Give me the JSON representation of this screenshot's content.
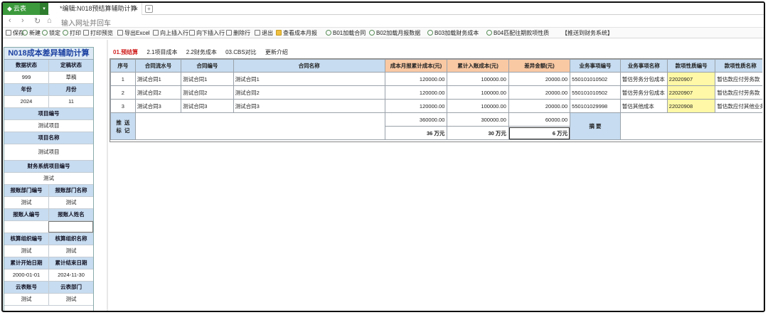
{
  "tabs": {
    "app_label": "云表",
    "doc_label": "*编辑:N018预结算辅助计算",
    "close": "×"
  },
  "address": {
    "placeholder": "输入网址并回车"
  },
  "toolbar": [
    {
      "label": "保存",
      "icon": "save-icon"
    },
    {
      "label": "新建",
      "icon": "new-icon"
    },
    {
      "label": "锁定",
      "icon": "lock-icon"
    },
    {
      "label": "打印",
      "icon": "print-icon"
    },
    {
      "label": "打印预览",
      "icon": "print-preview-icon"
    },
    {
      "label": "导出Excel",
      "icon": "excel-icon"
    },
    {
      "label": "向上插入行",
      "icon": "insert-up-icon"
    },
    {
      "label": "向下插入行",
      "icon": "insert-down-icon"
    },
    {
      "label": "删除行",
      "icon": "delete-row-icon"
    },
    {
      "label": "退出",
      "icon": "exit-icon"
    },
    {
      "label": "查看成本月报",
      "icon": "folder-icon"
    },
    {
      "label": "B01加载合同",
      "icon": "circle-icon"
    },
    {
      "label": "B02加载月报数据",
      "icon": "circle-icon"
    },
    {
      "label": "B03加载财务成本",
      "icon": "circle-icon"
    },
    {
      "label": "B04匹配往期款项性质",
      "icon": "circle-icon"
    },
    {
      "label": "【推送到财务系统】",
      "icon": ""
    }
  ],
  "left": {
    "title": "N018成本差异辅助计算",
    "data_status_label": "数据状态",
    "data_status": "999",
    "draft_status_label": "定稿状态",
    "draft_status": "草稿",
    "year_label": "年份",
    "year": "2024",
    "month_label": "月份",
    "month": "11",
    "project_no_label": "项目编号",
    "project_no": "测试项目",
    "project_name_label": "项目名称",
    "project_name": "测试项目",
    "fin_project_no_label": "财务系统项目编号",
    "fin_project_no": "测试",
    "dept_no_label": "报账部门编号",
    "dept_no": "测试",
    "dept_name_label": "报账部门名称",
    "dept_name": "测试",
    "person_no_label": "报账人编号",
    "person_no": "",
    "person_name_label": "报账人姓名",
    "person_name": "",
    "org_no_label": "核算组织编号",
    "org_no": "测试",
    "org_name_label": "核算组织名称",
    "org_name": "测试",
    "start_label": "累计开始日期",
    "start": "2000-01-01",
    "end_label": "累计结束日期",
    "end": "2024-11-30",
    "acct_label": "云表账号",
    "acct": "测试",
    "acct_dept_label": "云表部门",
    "acct_dept": "测试"
  },
  "right_tabs": [
    {
      "label": "01.预结算",
      "active": true
    },
    {
      "label": "2.1项目成本",
      "active": false
    },
    {
      "label": "2.2财务成本",
      "active": false
    },
    {
      "label": "03.CBS对比",
      "active": false
    },
    {
      "label": "更新介绍",
      "active": false
    }
  ],
  "table": {
    "headers": [
      "序号",
      "合同流水号",
      "合同编号",
      "合同名称",
      "成本月报累计成本(元)",
      "累计入账成本(元)",
      "差异金额(元)",
      "业务事项编号",
      "业务事项名称",
      "款项性质编号",
      "款项性质名称"
    ],
    "rows": [
      {
        "seq": "1",
        "flow": "测试合同1",
        "code": "测试合同1",
        "name": "测试合同1",
        "report": "120000.00",
        "booked": "100000.00",
        "diff": "20000.00",
        "biz_no": "550101010502",
        "biz_name": "暂估劳务分包成本",
        "nature_no": "22020907",
        "nature_name": "暂估款应付劳务款"
      },
      {
        "seq": "2",
        "flow": "测试合同2",
        "code": "测试合同2",
        "name": "测试合同2",
        "report": "120000.00",
        "booked": "100000.00",
        "diff": "20000.00",
        "biz_no": "550101010502",
        "biz_name": "暂估劳务分包成本",
        "nature_no": "22020907",
        "nature_name": "暂估款应付劳务款"
      },
      {
        "seq": "3",
        "flow": "测试合同3",
        "code": "测试合同3",
        "name": "测试合同3",
        "report": "120000.00",
        "booked": "100000.00",
        "diff": "20000.00",
        "biz_no": "550101029998",
        "biz_name": "暂估其他成本",
        "nature_no": "22020908",
        "nature_name": "暂估款应付其他业务"
      }
    ],
    "push_label": "推送标记",
    "total_report": "360000.00",
    "total_booked": "300000.00",
    "total_diff": "60000.00",
    "wan_report": "36 万元",
    "wan_booked": "30 万元",
    "wan_diff": "6 万元",
    "summary_label": "摘 要"
  }
}
